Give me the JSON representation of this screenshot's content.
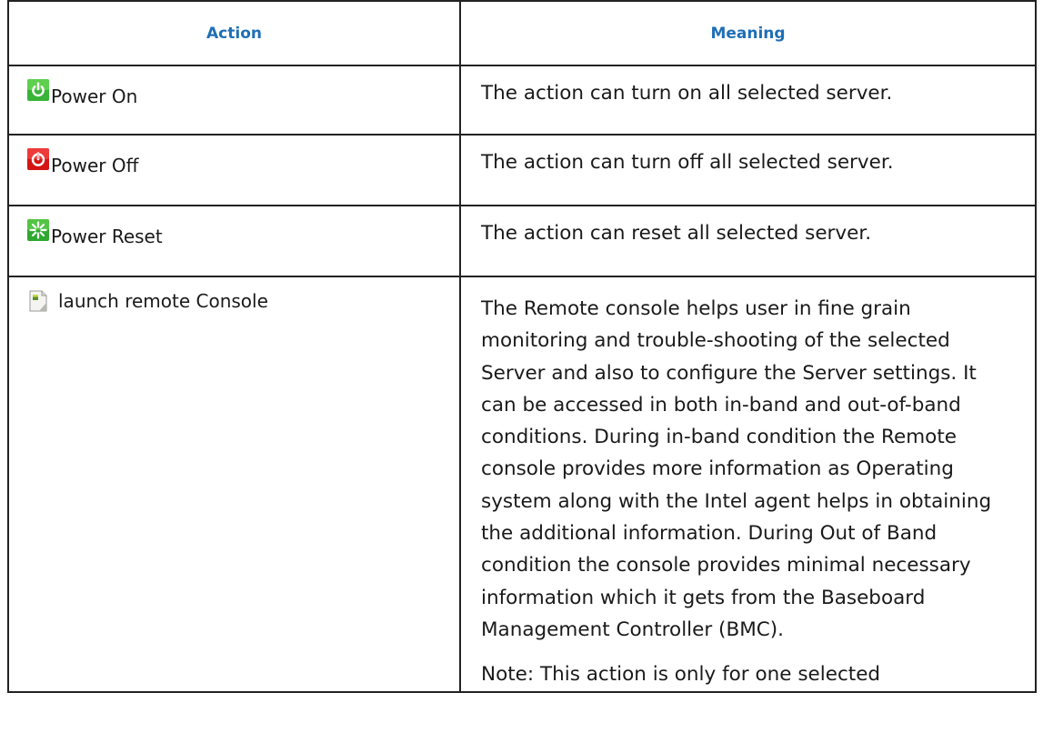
{
  "table": {
    "headers": {
      "action": "Action",
      "meaning": "Meaning"
    },
    "rows": [
      {
        "icon": "power-on-icon",
        "action": "Power On",
        "meaning": "The action can turn on all selected server."
      },
      {
        "icon": "power-off-icon",
        "action": "Power Off",
        "meaning": "The action can turn off all selected server."
      },
      {
        "icon": "power-reset-icon",
        "action": "Power Reset",
        "meaning": "The action can reset all selected server."
      },
      {
        "icon": "remote-console-icon",
        "action": "launch remote Console",
        "meaning": "The Remote console helps user in fine grain monitoring and trouble-shooting of the selected Server and also to configure the Server settings. It can be accessed in both in-band and out-of-band conditions. During in-band condition the Remote console provides more information as Operating system along with the Intel agent helps in obtaining the additional information. During Out of Band condition the console provides minimal necessary information which it gets from the Baseboard Management Controller (BMC).",
        "note": "Note: This action is only for one selected"
      }
    ]
  },
  "colors": {
    "header_text": "#1f6fb5",
    "border": "#222222",
    "power_on": "#2eaa2e",
    "power_off": "#d81a1a",
    "power_reset": "#2fb52f"
  }
}
